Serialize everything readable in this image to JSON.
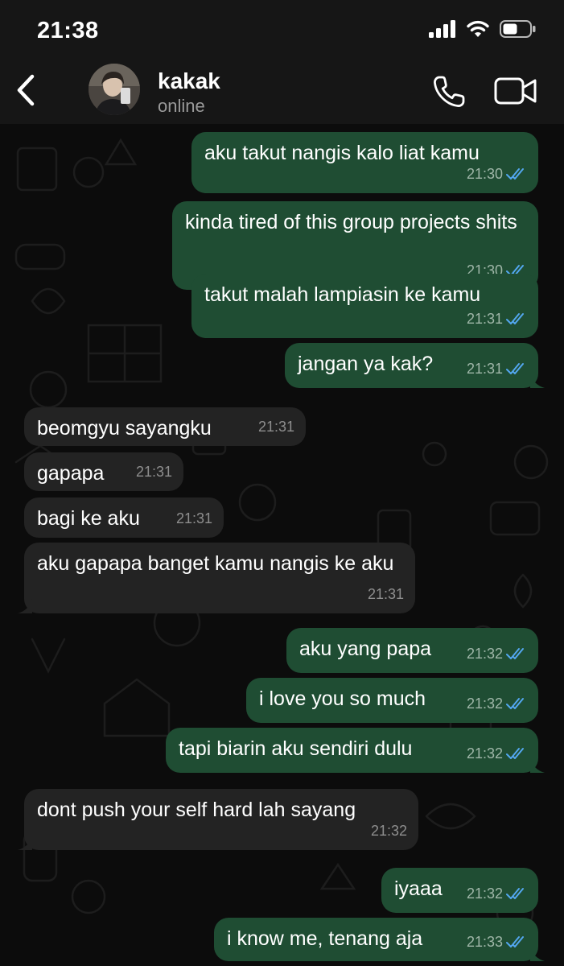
{
  "status": {
    "time": "21:38"
  },
  "contact": {
    "name": "kakak",
    "presence": "online"
  },
  "messages": [
    {
      "dir": "out",
      "text": "aku takut nangis kalo liat kamu",
      "time": "21:30"
    },
    {
      "dir": "out",
      "text": "kinda tired of this group projects shits",
      "time": "21:30"
    },
    {
      "dir": "out",
      "text": "takut malah lampiasin ke kamu",
      "time": "21:31"
    },
    {
      "dir": "out",
      "text": "jangan ya kak?",
      "time": "21:31"
    },
    {
      "dir": "in",
      "text": "beomgyu sayangku",
      "time": "21:31"
    },
    {
      "dir": "in",
      "text": "gapapa",
      "time": "21:31"
    },
    {
      "dir": "in",
      "text": "bagi ke aku",
      "time": "21:31"
    },
    {
      "dir": "in",
      "text": "aku gapapa banget kamu nangis ke aku",
      "time": "21:31"
    },
    {
      "dir": "out",
      "text": "aku yang papa",
      "time": "21:32"
    },
    {
      "dir": "out",
      "text": "i love you so much",
      "time": "21:32"
    },
    {
      "dir": "out",
      "text": "tapi biarin aku sendiri dulu",
      "time": "21:32"
    },
    {
      "dir": "in",
      "text": "dont push your self hard lah sayang",
      "time": "21:32"
    },
    {
      "dir": "out",
      "text": "iyaaa",
      "time": "21:32"
    },
    {
      "dir": "out",
      "text": "i know me, tenang aja",
      "time": "21:33"
    }
  ],
  "colors": {
    "outgoing": "#1f4d33",
    "incoming": "#232323",
    "read_ticks": "#53a7f0"
  },
  "icons": {
    "back": "chevron-left-icon",
    "call": "phone-icon",
    "video": "video-camera-icon",
    "read": "double-check-icon"
  }
}
